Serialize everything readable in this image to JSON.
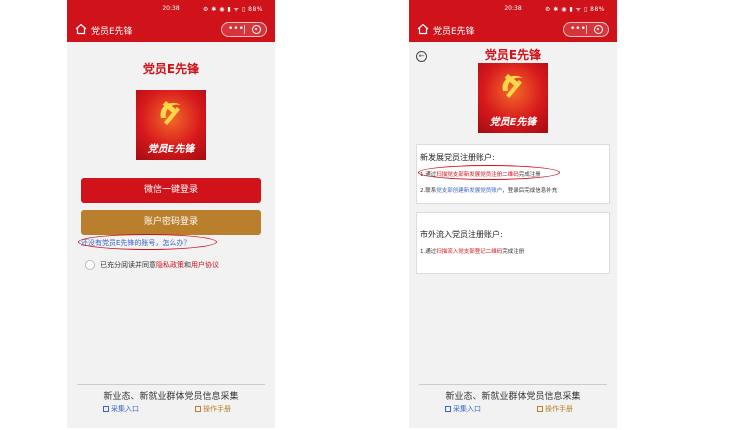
{
  "status_bar": {
    "time": "20:38",
    "indicators": "⚙ ✱ ◉ ▮ ᯤ ▯ 88%"
  },
  "nav": {
    "title": "党员E先锋",
    "menu_dots": "•••"
  },
  "app_title": "党员E先锋",
  "logo": {
    "text": "党员E先锋",
    "colors": [
      "#d7191c",
      "#f36b2a",
      "#ffd84a"
    ]
  },
  "login": {
    "wechat_button": "微信一键登录",
    "account_button": "账户密码登录",
    "no_account_hint": "还没有党员E先锋的账号，怎么办？",
    "agree_prefix": "已充分阅读并同意",
    "privacy_link": "隐私政策",
    "and": "和",
    "user_agreement_link": "用户协议"
  },
  "register": {
    "new_member_title": "新发展党员注册账户:",
    "new_line1_prefix": "1.通过",
    "new_line1_link": "扫描党支部新发展党员注册二维码",
    "new_line1_suffix": "完成注册",
    "new_line2_prefix": "2.联系",
    "new_line2_link": "党支部创建新发展党员账户",
    "new_line2_suffix": "，登录后完成信息补充",
    "outside_title": "市外流入党员注册账户:",
    "out_line1_prefix": "1.通过",
    "out_line1_link": "扫描流入党支部登记二维码",
    "out_line1_suffix": "完成注册"
  },
  "footer": {
    "title": "新业态、新就业群体党员信息采集",
    "collect_link": "采集入口",
    "manual_link": "操作手册"
  },
  "theme": {
    "primary_red": "#d0121b",
    "gold": "#b97f2c",
    "link_blue": "#3a64c9"
  }
}
